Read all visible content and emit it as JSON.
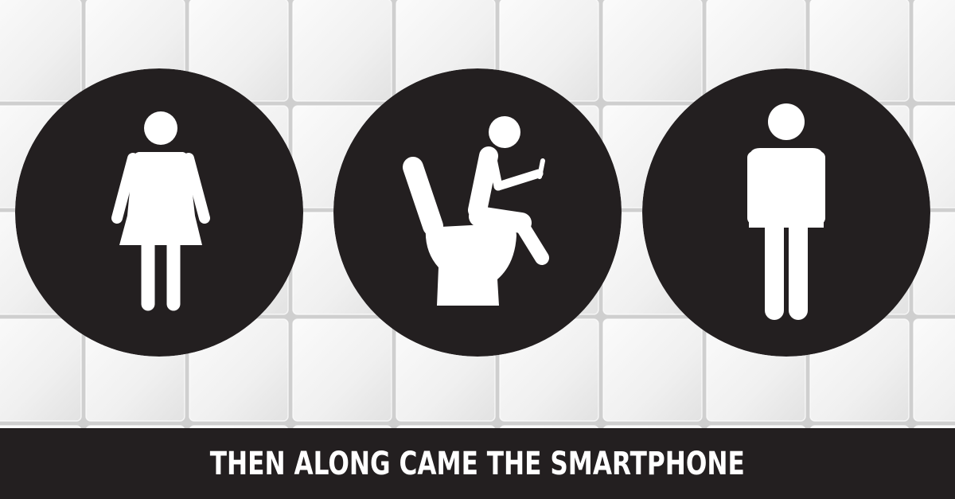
{
  "caption": {
    "text": "THEN ALONG CAME THE SMARTPHONE"
  },
  "signs": [
    {
      "icon": "woman-restroom-icon"
    },
    {
      "icon": "person-on-toilet-using-phone-icon"
    },
    {
      "icon": "man-restroom-icon"
    }
  ],
  "colors": {
    "sign_background": "#231f20",
    "figure": "#ffffff",
    "tile_face": "#f2f2f2",
    "tile_grout": "#d4d4d4",
    "caption_bar": "#231f20",
    "caption_text": "#ffffff"
  }
}
